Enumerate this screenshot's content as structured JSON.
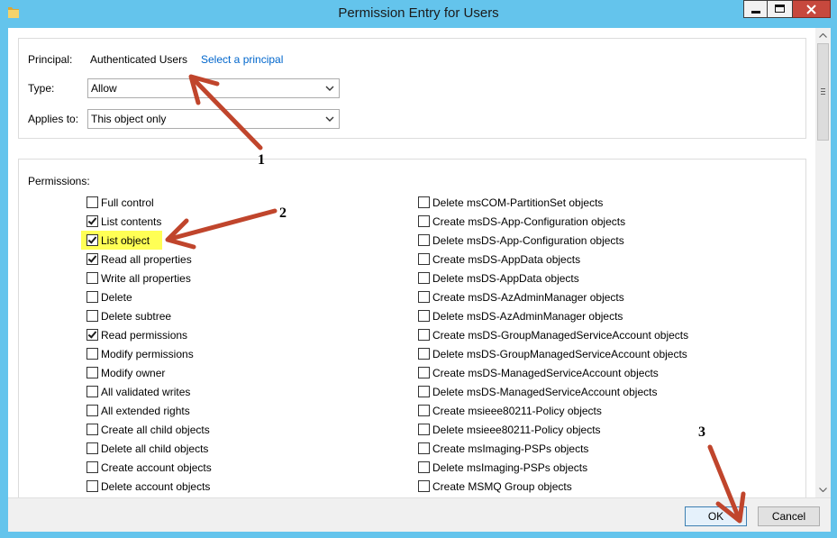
{
  "window": {
    "title": "Permission Entry for Users",
    "icon": "folder-icon",
    "controls": [
      "minimize-icon",
      "maximize-icon",
      "close-icon"
    ]
  },
  "principal": {
    "label": "Principal:",
    "value": "Authenticated Users",
    "link": "Select a principal"
  },
  "type": {
    "label": "Type:",
    "value": "Allow"
  },
  "applies_to": {
    "label": "Applies to:",
    "value": "This object only"
  },
  "permissions": {
    "label": "Permissions:",
    "left": [
      {
        "label": "Full control",
        "checked": false
      },
      {
        "label": "List contents",
        "checked": true
      },
      {
        "label": "List object",
        "checked": true,
        "highlighted": true
      },
      {
        "label": "Read all properties",
        "checked": true
      },
      {
        "label": "Write all properties",
        "checked": false
      },
      {
        "label": "Delete",
        "checked": false
      },
      {
        "label": "Delete subtree",
        "checked": false
      },
      {
        "label": "Read permissions",
        "checked": true
      },
      {
        "label": "Modify permissions",
        "checked": false
      },
      {
        "label": "Modify owner",
        "checked": false
      },
      {
        "label": "All validated writes",
        "checked": false
      },
      {
        "label": "All extended rights",
        "checked": false
      },
      {
        "label": "Create all child objects",
        "checked": false
      },
      {
        "label": "Delete all child objects",
        "checked": false
      },
      {
        "label": "Create account objects",
        "checked": false
      },
      {
        "label": "Delete account objects",
        "checked": false
      }
    ],
    "right": [
      {
        "label": "Delete msCOM-PartitionSet objects",
        "checked": false
      },
      {
        "label": "Create msDS-App-Configuration objects",
        "checked": false
      },
      {
        "label": "Delete msDS-App-Configuration objects",
        "checked": false
      },
      {
        "label": "Create msDS-AppData objects",
        "checked": false
      },
      {
        "label": "Delete msDS-AppData objects",
        "checked": false
      },
      {
        "label": "Create msDS-AzAdminManager objects",
        "checked": false
      },
      {
        "label": "Delete msDS-AzAdminManager objects",
        "checked": false
      },
      {
        "label": "Create msDS-GroupManagedServiceAccount objects",
        "checked": false
      },
      {
        "label": "Delete msDS-GroupManagedServiceAccount objects",
        "checked": false
      },
      {
        "label": "Create msDS-ManagedServiceAccount objects",
        "checked": false
      },
      {
        "label": "Delete msDS-ManagedServiceAccount objects",
        "checked": false
      },
      {
        "label": "Create msieee80211-Policy objects",
        "checked": false
      },
      {
        "label": "Delete msieee80211-Policy objects",
        "checked": false
      },
      {
        "label": "Create msImaging-PSPs objects",
        "checked": false
      },
      {
        "label": "Delete msImaging-PSPs objects",
        "checked": false
      },
      {
        "label": "Create MSMQ Group objects",
        "checked": false
      }
    ]
  },
  "buttons": {
    "ok": "OK",
    "cancel": "Cancel"
  },
  "annotations": [
    "1",
    "2",
    "3"
  ],
  "colors": {
    "title_bar": "#64c4ec",
    "close_button": "#c7483d",
    "link": "#0066cc",
    "highlight": "#ffff55",
    "annotation_arrow": "#c0452c"
  }
}
